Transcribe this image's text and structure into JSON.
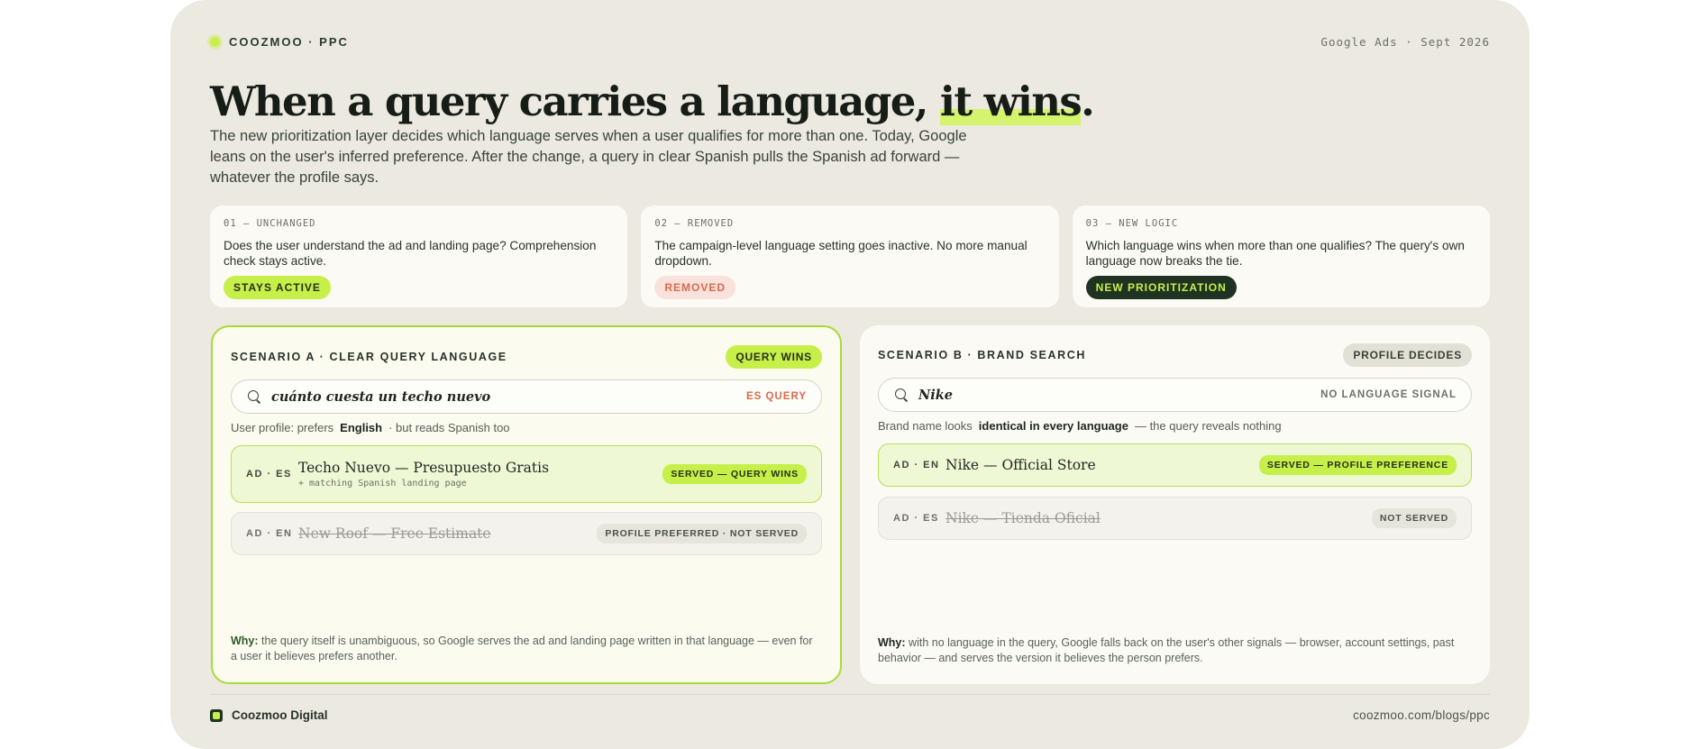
{
  "header": {
    "brand": "COOZMOO · PPC",
    "dateline": "Google Ads · Sept 2026"
  },
  "headline": {
    "lead": "When a query carries a language, ",
    "highlight": "it wins",
    "end": "."
  },
  "subcopy": "The new prioritization layer decides which language serves when a user qualifies for more than one. Today, Google leans on the user's inferred preference. After the change, a query in clear Spanish pulls the Spanish ad forward — whatever the profile says.",
  "steps": [
    {
      "code": "01 — UNCHANGED",
      "text": "Does the user understand the ad and landing page? Comprehension check stays active.",
      "chip": "STAYS ACTIVE"
    },
    {
      "code": "02 — REMOVED",
      "text": "The campaign-level language setting goes inactive. No more manual dropdown.",
      "chip": "REMOVED"
    },
    {
      "code": "03 — NEW LOGIC",
      "text": "Which language wins when more than one qualifies? The query's own language now breaks the tie.",
      "chip": "NEW PRIORITIZATION"
    }
  ],
  "scenario_a": {
    "title": "SCENARIO A · CLEAR QUERY LANGUAGE",
    "badge": "QUERY WINS",
    "query": "cuánto cuesta un techo nuevo",
    "query_tag": "ES QUERY",
    "profile_prefix": "User profile: prefers",
    "profile_value": "English",
    "profile_suffix": "· but reads Spanish too",
    "ads": [
      {
        "tag": "AD · ES",
        "title": "Techo Nuevo — Presupuesto Gratis",
        "sub": "+ matching Spanish landing page",
        "badge": "SERVED — QUERY WINS"
      },
      {
        "tag": "AD · EN",
        "title": "New Roof — Free Estimate",
        "badge": "PROFILE PREFERRED · NOT SERVED"
      }
    ],
    "why_label": "Why:",
    "why_text": "the query itself is unambiguous, so Google serves the ad and landing page written in that language — even for a user it believes prefers another."
  },
  "scenario_b": {
    "title": "SCENARIO B · BRAND SEARCH",
    "badge": "PROFILE DECIDES",
    "query": "Nike",
    "query_tag": "NO LANGUAGE SIGNAL",
    "profile_prefix": "Brand name looks",
    "profile_value": "identical in every language",
    "profile_suffix": "— the query reveals nothing",
    "ads": [
      {
        "tag": "AD · EN",
        "title": "Nike — Official Store",
        "badge": "SERVED — PROFILE PREFERENCE"
      },
      {
        "tag": "AD · ES",
        "title": "Nike — Tienda Oficial",
        "badge": "NOT SERVED"
      }
    ],
    "why_label": "Why:",
    "why_text": "with no language in the query, Google falls back on the user's other signals — browser, account settings, past behavior — and serves the version it believes the person prefers."
  },
  "footer": {
    "brand": "Coozmoo Digital",
    "url": "coozmoo.com/blogs/ppc"
  },
  "colors": {
    "accent": "#c7ef4a",
    "dark": "#1f3322",
    "removed": "#d86a4e",
    "background": "#ebe9e0"
  }
}
